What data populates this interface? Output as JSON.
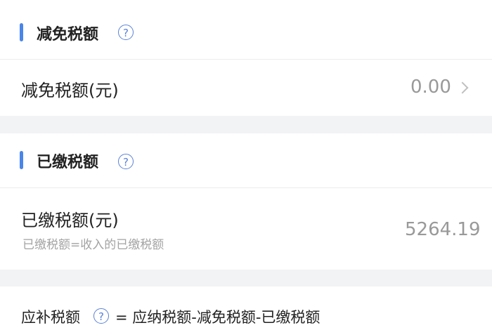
{
  "reduction": {
    "section_title": "减免税额",
    "row_label": "减免税额(元)",
    "row_value": "0.00"
  },
  "paid": {
    "section_title": "已缴税额",
    "row_label": "已缴税额(元)",
    "row_sub": "已缴税额=收入的已缴税额",
    "row_value": "5264.19"
  },
  "footer": {
    "label": "应补税额",
    "formula": "= 应纳税额-减免税额-已缴税额"
  },
  "help_glyph": "?",
  "colors": {
    "accent": "#4a86e8",
    "annotation": "#d93a3a"
  }
}
